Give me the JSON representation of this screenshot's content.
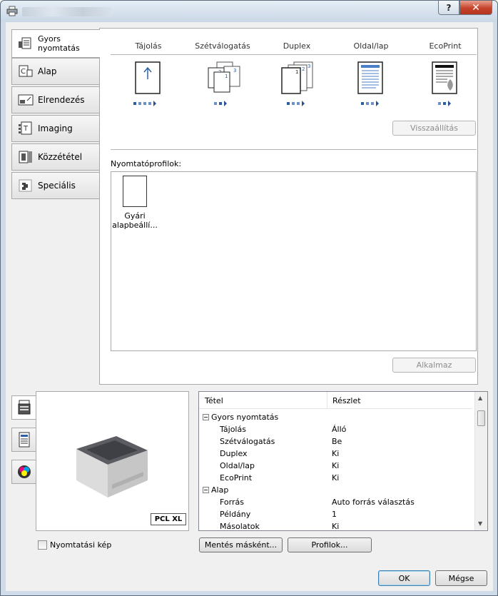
{
  "titlebar": {
    "help_label": "?",
    "close_label": "✕"
  },
  "tabs": [
    {
      "label": "Gyors nyomtatás",
      "icon": "quick-print-icon"
    },
    {
      "label": "Alap",
      "icon": "basic-icon"
    },
    {
      "label": "Elrendezés",
      "icon": "layout-icon"
    },
    {
      "label": "Imaging",
      "icon": "imaging-icon"
    },
    {
      "label": "Közzététel",
      "icon": "publishing-icon"
    },
    {
      "label": "Speciális",
      "icon": "advanced-icon"
    }
  ],
  "quick": {
    "columns": [
      "Tájolás",
      "Szétválogatás",
      "Duplex",
      "Oldal/lap",
      "EcoPrint"
    ],
    "reset_label": "Visszaállítás",
    "profiles_label": "Nyomtatóprofilok:",
    "profile_name": "Gyári alapbeállí...",
    "apply_label": "Alkalmaz"
  },
  "preview": {
    "badge": "PCL XL",
    "print_image_label": "Nyomtatási kép"
  },
  "detail": {
    "col_item": "Tétel",
    "col_detail": "Részlet",
    "groups": [
      {
        "name": "Gyors nyomtatás",
        "rows": [
          [
            "Tájolás",
            "Álló"
          ],
          [
            "Szétválogatás",
            "Be"
          ],
          [
            "Duplex",
            "Ki"
          ],
          [
            "Oldal/lap",
            "Ki"
          ],
          [
            "EcoPrint",
            "Ki"
          ]
        ]
      },
      {
        "name": "Alap",
        "rows": [
          [
            "Forrás",
            "Auto forrás választás"
          ],
          [
            "Példány",
            "1"
          ],
          [
            "Másolatok",
            "Ki"
          ]
        ]
      }
    ]
  },
  "buttons": {
    "save_as": "Mentés másként...",
    "profiles": "Profilok...",
    "ok": "OK",
    "cancel": "Mégse"
  }
}
